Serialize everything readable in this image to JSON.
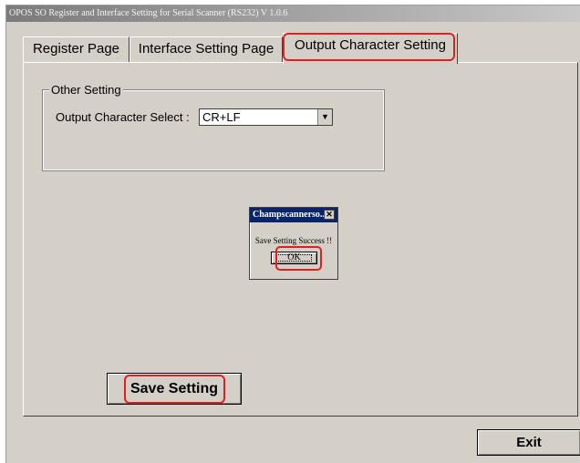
{
  "window": {
    "title": "OPOS SO Register and Interface Setting for Serial Scanner (RS232) V 1.0.6"
  },
  "tabs": [
    {
      "label": "Register Page",
      "active": false
    },
    {
      "label": "Interface Setting Page",
      "active": false
    },
    {
      "label": "Output Character Setting",
      "active": true
    }
  ],
  "other_setting": {
    "group_label": "Other Setting",
    "ocs_label": "Output Character Select :",
    "ocs_value": "CR+LF"
  },
  "dialog": {
    "title": "Champscannerso...",
    "message": "Save Setting Success !!",
    "ok_label": "OK",
    "close_icon": "close-icon"
  },
  "buttons": {
    "save_label": "Save Setting",
    "exit_label": "Exit"
  },
  "colors": {
    "highlight": "#e02020",
    "dialog_title_bg": "#0a246a",
    "window_bg": "#d4d0c8"
  }
}
